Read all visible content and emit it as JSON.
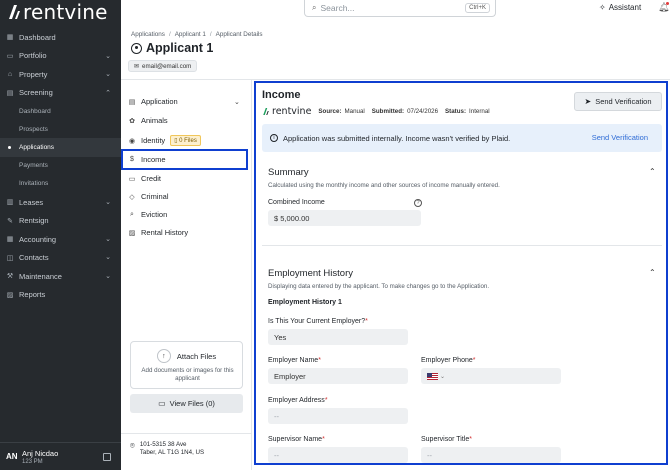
{
  "app": {
    "logo_text": "rentvine"
  },
  "sidebar": {
    "items": [
      {
        "label": "Dashboard",
        "icon": "dashboard-icon"
      },
      {
        "label": "Portfolio",
        "icon": "portfolio-icon",
        "chevron": true
      },
      {
        "label": "Property",
        "icon": "property-icon",
        "chevron": true
      },
      {
        "label": "Screening",
        "icon": "screening-icon",
        "chevron": true
      }
    ],
    "screening_sub": [
      "Dashboard",
      "Prospects",
      "Applications",
      "Payments",
      "Invitations"
    ],
    "active_sub": "Applications",
    "items_after": [
      {
        "label": "Leases",
        "icon": "leases-icon",
        "chevron": true
      },
      {
        "label": "Rentsign",
        "icon": "rentsign-icon"
      },
      {
        "label": "Accounting",
        "icon": "accounting-icon",
        "chevron": true
      },
      {
        "label": "Contacts",
        "icon": "contacts-icon",
        "chevron": true
      },
      {
        "label": "Maintenance",
        "icon": "maintenance-icon",
        "chevron": true
      },
      {
        "label": "Reports",
        "icon": "reports-icon"
      }
    ],
    "user": {
      "initials": "AN",
      "name": "Anj Nicdao",
      "time": "123 PM"
    }
  },
  "topbar": {
    "search_placeholder": "Search...",
    "shortcut": "Ctrl+K",
    "assistant_label": "Assistant"
  },
  "header": {
    "breadcrumbs": [
      "Applications",
      "Applicant 1",
      "Applicant Details"
    ],
    "title": "Applicant 1",
    "email": "email@email.com"
  },
  "subnav": {
    "application": "Application",
    "animals": "Animals",
    "identity": "Identity",
    "identity_badge": "0 Files",
    "income": "Income",
    "credit": "Credit",
    "criminal": "Criminal",
    "eviction": "Eviction",
    "rental_history": "Rental History"
  },
  "attach": {
    "title": "Attach Files",
    "desc": "Add documents or images for this applicant",
    "view_files": "View Files (0)"
  },
  "address": {
    "line1": "101-5315 38 Ave",
    "line2": "Taber, AL T1G 1N4, US"
  },
  "income": {
    "title": "Income",
    "logo_text": "rentvine",
    "source_label": "Source:",
    "source": "Manual",
    "submitted_label": "Submitted:",
    "submitted": "07/24/2026",
    "status_label": "Status:",
    "status": "Internal",
    "send_button": "Send Verification",
    "alert_text": "Application was submitted internally. Income wasn't verified by Plaid.",
    "alert_link": "Send Verification",
    "summary": {
      "title": "Summary",
      "desc": "Calculated using the monthly income and other sources of income manually entered.",
      "combined_label": "Combined Income",
      "combined_value": "$  5,000.00"
    },
    "employment": {
      "title": "Employment History",
      "desc": "Displaying data entered by the applicant. To make changes go to the Application.",
      "subtitle": "Employment History 1",
      "current_label": "Is This Your Current Employer?",
      "current_value": "Yes",
      "employer_name_label": "Employer Name",
      "employer_name_value": "Employer",
      "employer_phone_label": "Employer Phone",
      "employer_phone_value": "",
      "employer_address_label": "Employer Address",
      "employer_address_value": "--",
      "supervisor_name_label": "Supervisor Name",
      "supervisor_name_value": "--",
      "supervisor_title_label": "Supervisor Title",
      "supervisor_title_value": "--"
    }
  }
}
